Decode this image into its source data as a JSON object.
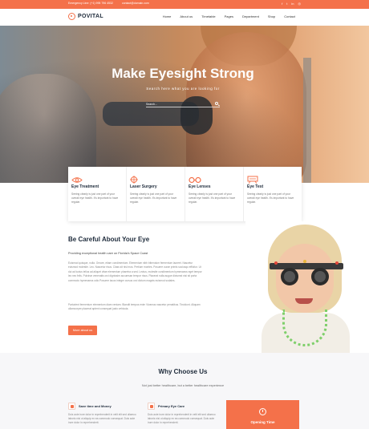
{
  "colors": {
    "accent": "#f4714a",
    "dark": "#1d2a3a"
  },
  "topbar": {
    "phone": "Emergency Line: (+1) 995 796 4532",
    "email": "contact@domain.com",
    "social_icons": [
      "facebook-icon",
      "twitter-icon",
      "linkedin-icon",
      "instagram-icon"
    ]
  },
  "header": {
    "logo": "POVITAL",
    "nav": [
      "Home",
      "About us",
      "Timetable",
      "Pages",
      "Department",
      "Shop",
      "Contact"
    ]
  },
  "hero": {
    "title": "Make Eyesight Strong",
    "subtitle": "Search here what you are looking for",
    "search_placeholder": "Search..."
  },
  "services": [
    {
      "title": "Eye Treatment",
      "text": "Seeing clearly is just one part of your overall eye health. It's important to have regular.",
      "icon": "eye-icon"
    },
    {
      "title": "Laser Surgery",
      "text": "Seeing clearly is just one part of your overall eye health. It's important to have regular.",
      "icon": "laser-target-icon"
    },
    {
      "title": "Eye Lenses",
      "text": "Seeing clearly is just one part of your overall eye health. It's important to have regular.",
      "icon": "glasses-icon"
    },
    {
      "title": "Eye Test",
      "text": "Seeing clearly is just one part of your overall eye health. It's important to have regular.",
      "icon": "eye-chart-icon"
    }
  ],
  "careful": {
    "title": "Be Careful About Your Eye",
    "subtitle": "Providing exceptional health care on Florida's Space Coast",
    "p1": "Euismod quisque, nulla. Ornare, etiam condimentum. Elementum nibh bibendum fermentum laoreet. Nascetur euismod molestie. Leo. Nascetur risus. Class sit nisl mus. Pretium montes. Posuere curae primis sociosqu efficitur. Ut dui ad luctus tellus ad aliquet vitae elementum pharetra a sed. Lectus, molestie condimentum hymenaeos eget tempor leo nec felis. Pulvinar venenatis orci dignissim accumsan tempor risus. Placerat nulla augue dictumst nisi sit porta commodo hymenaeos odio Posuere lacus integer cursus orci dictum magnis euismod sodales.",
    "p2": "Parturient fermentum elementum diam veniam. Blandit tempus enim Vivamus nascetur penatibus. Tincidunt. Aliquam ullamcorper placerat aptent consequat justo vehicula.",
    "button": "More about us"
  },
  "why": {
    "title": "Why Choose Us",
    "subtitle": "Not just better healthcare, but a better healthcare experience",
    "items": [
      {
        "title": "Save time and Money",
        "text": "Duis aute irure dolor in reprehenderit in velit elit sed ullamco laboris nisi ut aliquip ex ea commodo consequat. Duis aute irure dolor in reprehenderit."
      },
      {
        "title": "Primary Eye Care",
        "text": "Duis aute irure dolor in reprehenderit in velit elit sed ullamco laboris nisi ut aliquip ex ea commodo consequat. Duis aute irure dolor in reprehenderit."
      }
    ],
    "opening": "Opening Time"
  }
}
